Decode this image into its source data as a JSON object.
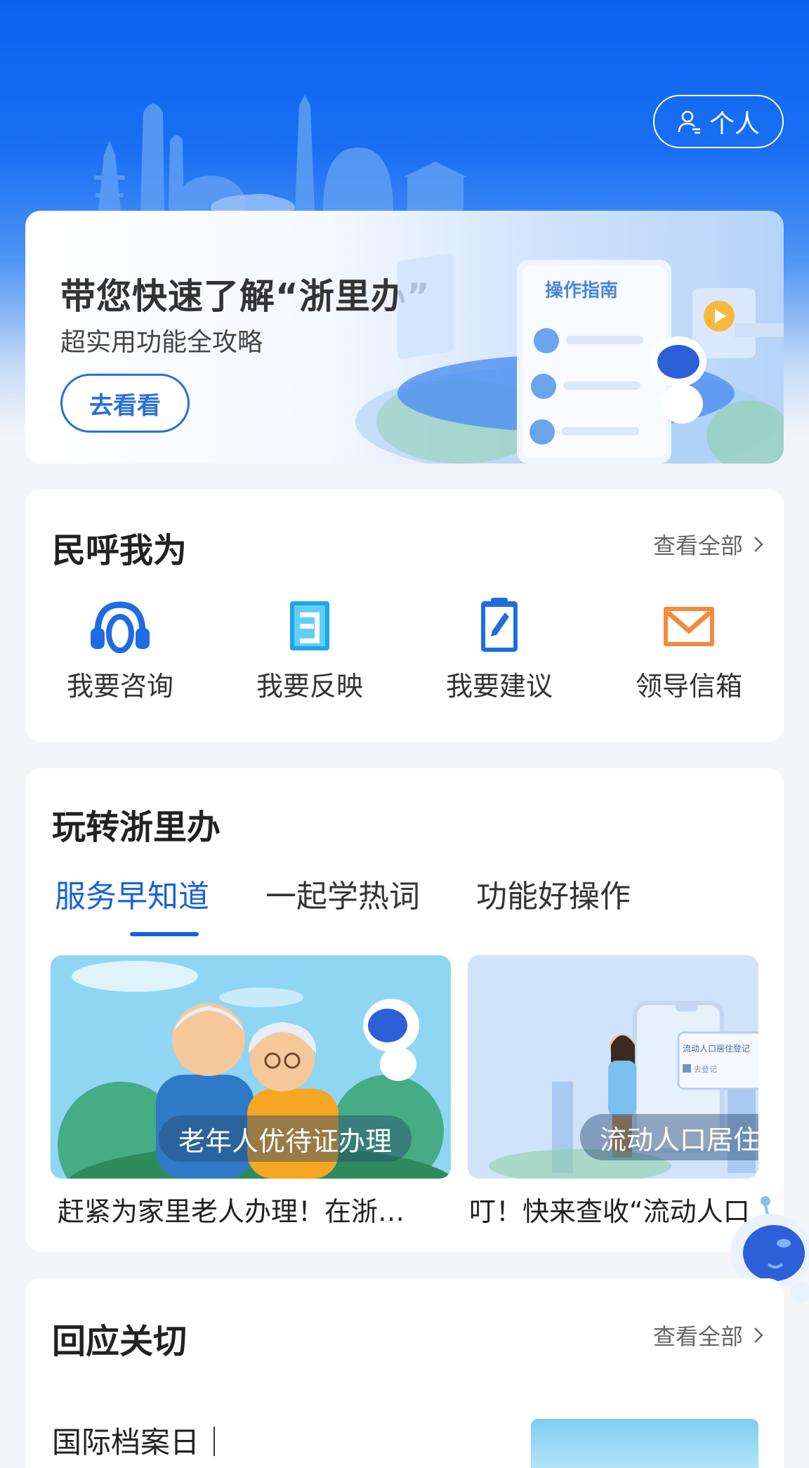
{
  "header": {
    "personal_label": "个人",
    "brand_color": "#1a62d8"
  },
  "guide_banner": {
    "title": "带您快速了解“浙里办”",
    "subtitle": "超实用功能全攻略",
    "button_label": "去看看",
    "illustration_label": "操作指南"
  },
  "min_hu": {
    "title": "民呼我为",
    "see_all": "查看全部",
    "items": [
      {
        "label": "我要咨询",
        "icon": "headset-icon"
      },
      {
        "label": "我要反映",
        "icon": "document-icon"
      },
      {
        "label": "我要建议",
        "icon": "clipboard-pen-icon"
      },
      {
        "label": "领导信箱",
        "icon": "mail-icon"
      }
    ]
  },
  "play": {
    "title": "玩转浙里办",
    "tabs": [
      "服务早知道",
      "一起学热词",
      "功能好操作"
    ],
    "active_tab": 0,
    "cards": [
      {
        "caption": "老年人优待证办理",
        "desc": "赶紧为家里老人办理！在浙…"
      },
      {
        "caption": "流动人口居住",
        "desc": "叮！快来查收“流动人口"
      }
    ],
    "card2_screen_text": "流动人口居住登记",
    "card2_screen_sub": "去登记"
  },
  "response": {
    "title": "回应关切",
    "see_all": "查看全部",
    "first_item_title": "国际档案日｜"
  }
}
